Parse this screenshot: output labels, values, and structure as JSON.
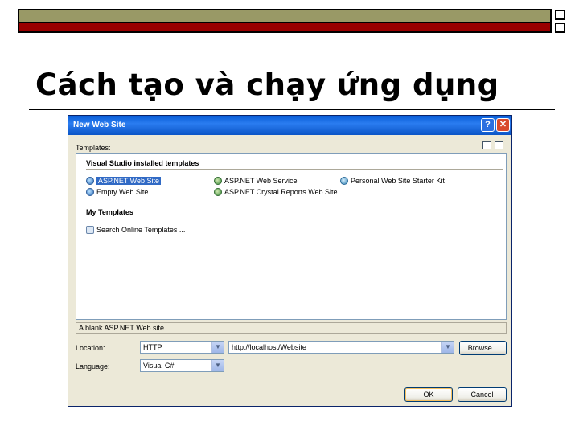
{
  "slide": {
    "title": "Cách tạo và chạy ứng dụng"
  },
  "dialog": {
    "title": "New Web Site",
    "help_button": "?",
    "close_button": "✕",
    "templates_label": "Templates:",
    "installed_heading": "Visual Studio installed templates",
    "installed_templates": [
      {
        "label": "ASP.NET Web Site",
        "icon": "globe-icon",
        "selected": true
      },
      {
        "label": "ASP.NET Web Service",
        "icon": "web-service-icon"
      },
      {
        "label": "Personal Web Site Starter Kit",
        "icon": "starter-kit-icon"
      },
      {
        "label": "Empty Web Site",
        "icon": "globe-icon"
      },
      {
        "label": "ASP.NET Crystal Reports Web Site",
        "icon": "web-service-icon"
      }
    ],
    "my_templates_heading": "My Templates",
    "my_templates": [
      {
        "label": "Search Online Templates ...",
        "icon": "search-templates-icon"
      }
    ],
    "description": "A blank ASP.NET Web site",
    "location_label": "Location:",
    "location_type": "HTTP",
    "location_value": "http://localhost/Website",
    "browse_button": "Browse...",
    "language_label": "Language:",
    "language_value": "Visual C#",
    "ok_button": "OK",
    "cancel_button": "Cancel"
  }
}
